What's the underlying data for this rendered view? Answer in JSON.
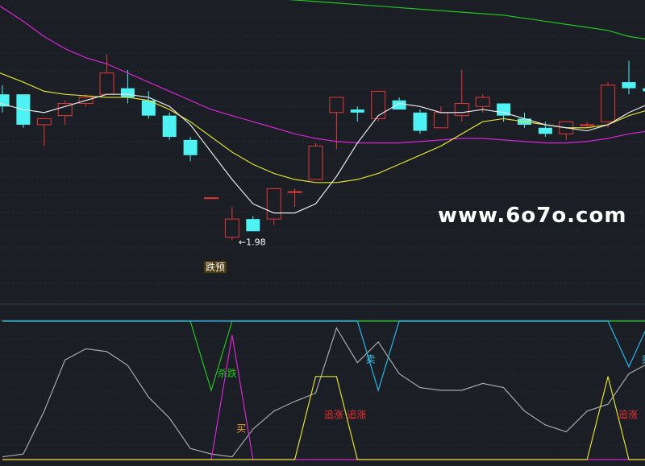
{
  "watermark": "www.6o7o.com",
  "colors": {
    "background": "#1b1e25",
    "grid": "#2a2e38",
    "up_candle": "#e53935",
    "down_candle": "#4ff2f2",
    "ma_green": "#22c422",
    "ma_magenta": "#d526d5",
    "ma_yellow": "#e0e030",
    "ma_white": "#e8e8e8",
    "osc_gray": "#a8a8a8",
    "signal_green": "#22c422",
    "signal_cyan": "#2ab7e8",
    "signal_magenta": "#d526d5",
    "signal_yellow": "#e0e030",
    "label_red": "#ee3030",
    "label_orange": "#f0a020",
    "label_cyan": "#38c8f0"
  },
  "chart_data": [
    {
      "type": "candlestick",
      "panel": "price",
      "ylim": [
        0,
        10
      ],
      "x": [
        0,
        1,
        2,
        3,
        4,
        5,
        6,
        7,
        8,
        9,
        10,
        11,
        12,
        13,
        14,
        15,
        16,
        17,
        18,
        19,
        20,
        21,
        22,
        23,
        24,
        25,
        26,
        27,
        28,
        29,
        30,
        31
      ],
      "candles": [
        {
          "o": 6.9,
          "h": 7.2,
          "l": 6.3,
          "c": 6.5
        },
        {
          "o": 6.9,
          "h": 6.9,
          "l": 5.8,
          "c": 5.9
        },
        {
          "o": 5.9,
          "h": 6.1,
          "l": 5.2,
          "c": 6.1
        },
        {
          "o": 6.2,
          "h": 6.7,
          "l": 5.9,
          "c": 6.6
        },
        {
          "o": 6.6,
          "h": 6.9,
          "l": 6.5,
          "c": 6.8
        },
        {
          "o": 6.9,
          "h": 8.2,
          "l": 6.9,
          "c": 7.6
        },
        {
          "o": 7.1,
          "h": 7.7,
          "l": 6.6,
          "c": 6.8
        },
        {
          "o": 6.7,
          "h": 7.0,
          "l": 6.1,
          "c": 6.2
        },
        {
          "o": 6.2,
          "h": 6.3,
          "l": 5.4,
          "c": 5.5
        },
        {
          "o": 5.4,
          "h": 5.5,
          "l": 4.7,
          "c": 4.9
        },
        {
          "o": 3.5,
          "h": 3.5,
          "l": 3.5,
          "c": 3.5
        },
        {
          "o": 2.2,
          "h": 3.2,
          "l": 2.1,
          "c": 2.8
        },
        {
          "o": 2.8,
          "h": 2.9,
          "l": 2.4,
          "c": 2.4
        },
        {
          "o": 2.8,
          "h": 3.8,
          "l": 2.6,
          "c": 3.8
        },
        {
          "o": 3.7,
          "h": 3.8,
          "l": 3.2,
          "c": 3.7
        },
        {
          "o": 4.1,
          "h": 5.3,
          "l": 4.1,
          "c": 5.2
        },
        {
          "o": 6.3,
          "h": 6.3,
          "l": 5.1,
          "c": 6.8
        },
        {
          "o": 6.4,
          "h": 6.5,
          "l": 6.0,
          "c": 6.3
        },
        {
          "o": 6.1,
          "h": 7.0,
          "l": 6.0,
          "c": 7.0
        },
        {
          "o": 6.7,
          "h": 6.8,
          "l": 6.5,
          "c": 6.4
        },
        {
          "o": 6.3,
          "h": 6.4,
          "l": 5.6,
          "c": 5.7
        },
        {
          "o": 5.8,
          "h": 6.5,
          "l": 5.8,
          "c": 6.3
        },
        {
          "o": 6.2,
          "h": 7.7,
          "l": 6.0,
          "c": 6.6
        },
        {
          "o": 6.5,
          "h": 6.9,
          "l": 6.3,
          "c": 6.8
        },
        {
          "o": 6.6,
          "h": 6.6,
          "l": 6.0,
          "c": 6.2
        },
        {
          "o": 6.1,
          "h": 6.3,
          "l": 5.8,
          "c": 5.9
        },
        {
          "o": 5.8,
          "h": 6.0,
          "l": 5.5,
          "c": 5.6
        },
        {
          "o": 5.6,
          "h": 6.0,
          "l": 5.4,
          "c": 6.0
        },
        {
          "o": 5.9,
          "h": 6.0,
          "l": 5.8,
          "c": 5.9
        },
        {
          "o": 6.0,
          "h": 7.3,
          "l": 5.8,
          "c": 7.2
        },
        {
          "o": 7.3,
          "h": 8.0,
          "l": 6.9,
          "c": 7.1
        },
        {
          "o": 7.1,
          "h": 7.3,
          "l": 6.9,
          "c": 7.0
        }
      ],
      "moving_averages": [
        {
          "color_key": "ma_green",
          "values": [
            10.7,
            10.65,
            10.6,
            10.55,
            10.5,
            10.45,
            10.4,
            10.35,
            10.3,
            10.25,
            10.2,
            10.15,
            10.1,
            10.05,
            10.0,
            9.95,
            9.9,
            9.85,
            9.8,
            9.75,
            9.7,
            9.65,
            9.6,
            9.55,
            9.5,
            9.4,
            9.3,
            9.2,
            9.1,
            9.0,
            8.8,
            8.7
          ]
        },
        {
          "color_key": "ma_magenta",
          "values": [
            9.8,
            9.3,
            8.8,
            8.4,
            8.1,
            7.9,
            7.6,
            7.3,
            7.0,
            6.7,
            6.4,
            6.2,
            6.0,
            5.8,
            5.6,
            5.45,
            5.35,
            5.3,
            5.3,
            5.3,
            5.35,
            5.4,
            5.45,
            5.45,
            5.4,
            5.35,
            5.3,
            5.3,
            5.35,
            5.45,
            5.6,
            5.7
          ]
        },
        {
          "color_key": "ma_yellow",
          "values": [
            7.6,
            7.3,
            7.0,
            6.9,
            6.85,
            6.8,
            6.8,
            6.7,
            6.4,
            6.0,
            5.5,
            5.0,
            4.6,
            4.3,
            4.1,
            4.0,
            4.0,
            4.1,
            4.3,
            4.6,
            4.9,
            5.2,
            5.6,
            6.0,
            6.1,
            6.0,
            5.9,
            5.8,
            5.8,
            5.9,
            6.2,
            6.4
          ]
        },
        {
          "color_key": "ma_white",
          "values": [
            6.6,
            6.4,
            6.3,
            6.5,
            6.7,
            6.9,
            6.9,
            6.8,
            6.5,
            5.9,
            5.0,
            4.1,
            3.3,
            3.0,
            3.0,
            3.3,
            4.2,
            5.3,
            6.2,
            6.6,
            6.5,
            6.3,
            6.3,
            6.4,
            6.3,
            6.1,
            5.9,
            5.8,
            5.7,
            5.9,
            6.3,
            6.6
          ]
        }
      ],
      "annotations": [
        {
          "text": "←1.98",
          "x": 11,
          "y": 2.05
        },
        {
          "text": "跌预",
          "x": 10,
          "y": 1.0
        }
      ]
    },
    {
      "type": "line",
      "panel": "indicator",
      "ylim": [
        0,
        100
      ],
      "x": [
        0,
        1,
        2,
        3,
        4,
        5,
        6,
        7,
        8,
        9,
        10,
        11,
        12,
        13,
        14,
        15,
        16,
        17,
        18,
        19,
        20,
        21,
        22,
        23,
        24,
        25,
        26,
        27,
        28,
        29,
        30,
        31
      ],
      "series": [
        {
          "color_key": "osc_gray",
          "values": [
            2,
            4,
            35,
            72,
            80,
            78,
            68,
            45,
            30,
            8,
            4,
            2,
            22,
            35,
            42,
            48,
            95,
            70,
            85,
            62,
            52,
            50,
            50,
            55,
            52,
            35,
            25,
            20,
            35,
            40,
            62,
            70
          ]
        },
        {
          "color_key": "signal_green",
          "values": [
            100,
            100,
            100,
            100,
            100,
            100,
            100,
            100,
            100,
            100,
            50,
            100,
            100,
            100,
            100,
            100,
            100,
            100,
            100,
            100,
            100,
            100,
            100,
            100,
            100,
            100,
            100,
            100,
            100,
            100,
            100,
            100
          ]
        },
        {
          "color_key": "signal_cyan",
          "values": [
            100,
            100,
            100,
            100,
            100,
            100,
            100,
            100,
            100,
            100,
            100,
            100,
            100,
            100,
            100,
            100,
            100,
            100,
            50,
            100,
            100,
            100,
            100,
            100,
            100,
            100,
            100,
            100,
            100,
            100,
            67,
            100
          ]
        },
        {
          "color_key": "signal_magenta",
          "values": [
            0,
            0,
            0,
            0,
            0,
            0,
            0,
            0,
            0,
            0,
            0,
            90,
            0,
            0,
            0,
            0,
            0,
            0,
            0,
            0,
            0,
            0,
            0,
            0,
            0,
            0,
            0,
            0,
            0,
            0,
            0,
            0
          ]
        },
        {
          "color_key": "signal_yellow",
          "values": [
            0,
            0,
            0,
            0,
            0,
            0,
            0,
            0,
            0,
            0,
            0,
            0,
            0,
            0,
            0,
            60,
            60,
            0,
            0,
            0,
            0,
            0,
            0,
            0,
            0,
            0,
            0,
            0,
            0,
            60,
            0,
            0
          ]
        }
      ],
      "labels": [
        {
          "text": "杀跌",
          "x": 10.3,
          "y": 60,
          "color_key": "signal_green"
        },
        {
          "text": "买",
          "x": 11.2,
          "y": 20,
          "color_key": "label_orange"
        },
        {
          "text": "追涨",
          "x": 15.4,
          "y": 30,
          "color_key": "label_red"
        },
        {
          "text": "追涨",
          "x": 16.5,
          "y": 30,
          "color_key": "label_red"
        },
        {
          "text": "卖",
          "x": 17.4,
          "y": 70,
          "color_key": "label_cyan"
        },
        {
          "text": "追涨",
          "x": 29.5,
          "y": 30,
          "color_key": "label_red"
        },
        {
          "text": "卖",
          "x": 30.6,
          "y": 70,
          "color_key": "label_cyan"
        }
      ]
    }
  ]
}
